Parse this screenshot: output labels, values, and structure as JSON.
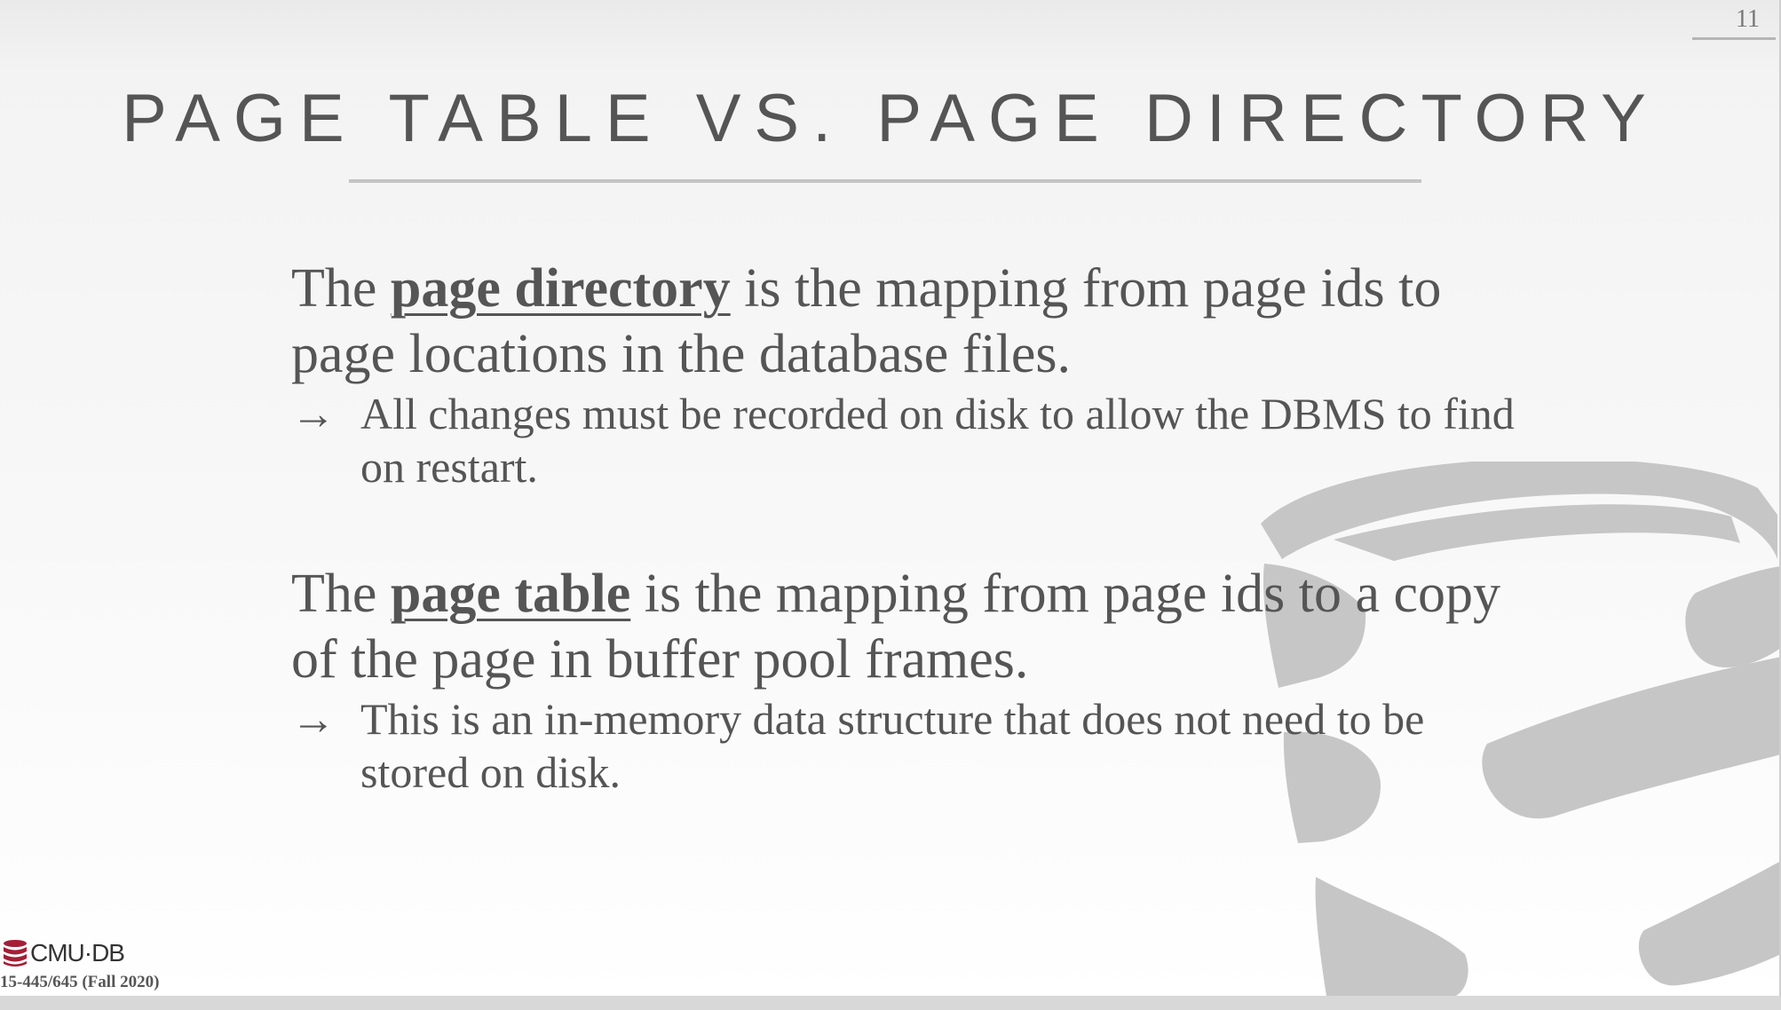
{
  "slide": {
    "page_number": "11",
    "title": "PAGE TABLE VS. PAGE DIRECTORY",
    "section1": {
      "pre": "The ",
      "term": "page directory",
      "post": " is the mapping from page ids to page locations in the database files.",
      "bullet": "All changes must be recorded on disk to allow the DBMS to find on restart."
    },
    "section2": {
      "pre": "The ",
      "term": "page table",
      "post": " is the mapping from page ids to a copy of the page in buffer pool frames.",
      "bullet": "This is an in-memory data structure that does not need to be stored on disk."
    },
    "arrow": "→"
  },
  "footer": {
    "brand": "CMU·DB",
    "course": "15-445/645 (Fall 2020)"
  },
  "colors": {
    "text": "#555555",
    "logo_gray": "#c6c6c6",
    "brand_red": "#a41f35"
  },
  "icons": {
    "background_logo": "database-icon",
    "footer_logo": "database-icon"
  }
}
